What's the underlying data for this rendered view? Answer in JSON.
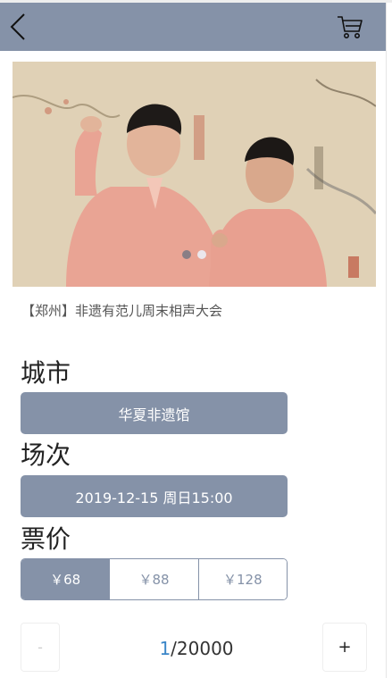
{
  "header": {
    "back_icon": "chevron-left-icon",
    "cart_icon": "shopping-cart-icon"
  },
  "banner": {
    "image": "photo of two performers in pink traditional robes",
    "slide_count": 2,
    "active_slide": 2
  },
  "event": {
    "title": "【郑州】非遗有范儿周末相声大会"
  },
  "city": {
    "label": "城市",
    "value": "华夏非遗馆"
  },
  "session": {
    "label": "场次",
    "value": "2019-12-15 周日15:00"
  },
  "price": {
    "label": "票价",
    "options": [
      "￥68",
      "￥88",
      "￥128"
    ],
    "selected_index": 0
  },
  "quantity": {
    "minus_label": "-",
    "plus_label": "+",
    "current": "1",
    "separator_max": "/20000"
  },
  "colors": {
    "accent": "#8592a8",
    "quantity_highlight": "#3a86c8"
  }
}
